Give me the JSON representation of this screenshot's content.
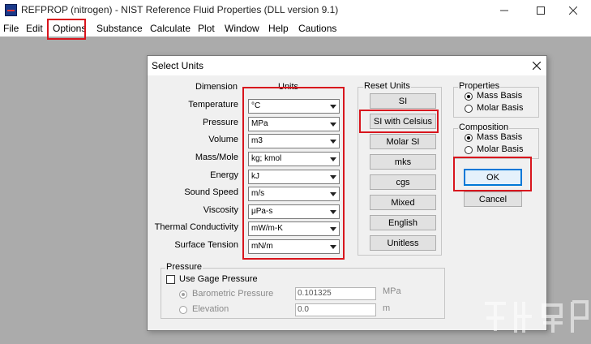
{
  "window": {
    "title": "REFPROP (nitrogen) - NIST Reference Fluid Properties (DLL version 9.1)"
  },
  "menu": [
    "File",
    "Edit",
    "Options",
    "Substance",
    "Calculate",
    "Plot",
    "Window",
    "Help",
    "Cautions"
  ],
  "dialog": {
    "title": "Select Units",
    "dimension_header": "Dimension",
    "units_header": "Units",
    "rows": [
      {
        "dimension": "Temperature",
        "unit": "°C"
      },
      {
        "dimension": "Pressure",
        "unit": "MPa"
      },
      {
        "dimension": "Volume",
        "unit": "m3"
      },
      {
        "dimension": "Mass/Mole",
        "unit": "kg; kmol"
      },
      {
        "dimension": "Energy",
        "unit": "kJ"
      },
      {
        "dimension": "Sound Speed",
        "unit": "m/s"
      },
      {
        "dimension": "Viscosity",
        "unit": "μPa-s"
      },
      {
        "dimension": "Thermal Conductivity",
        "unit": "mW/m-K"
      },
      {
        "dimension": "Surface Tension",
        "unit": "mN/m"
      }
    ],
    "reset_units": {
      "title": "Reset Units",
      "buttons": [
        "SI",
        "SI with Celsius",
        "Molar SI",
        "mks",
        "cgs",
        "Mixed",
        "English",
        "Unitless"
      ]
    },
    "properties": {
      "title": "Properties",
      "options": [
        "Mass Basis",
        "Molar Basis"
      ],
      "selected": "Mass Basis"
    },
    "composition": {
      "title": "Composition",
      "options": [
        "Mass Basis",
        "Molar Basis"
      ],
      "selected": "Mass Basis"
    },
    "ok_label": "OK",
    "cancel_label": "Cancel",
    "pressure": {
      "title": "Pressure",
      "use_gage_label": "Use Gage Pressure",
      "barometric_label": "Barometric Pressure",
      "barometric_value": "0.101325",
      "barometric_unit": "MPa",
      "elevation_label": "Elevation",
      "elevation_value": "0.0",
      "elevation_unit": "m"
    }
  },
  "colors": {
    "highlight": "#d8151d",
    "workspace": "#ababab",
    "dialog_bg": "#f0f0f0"
  }
}
